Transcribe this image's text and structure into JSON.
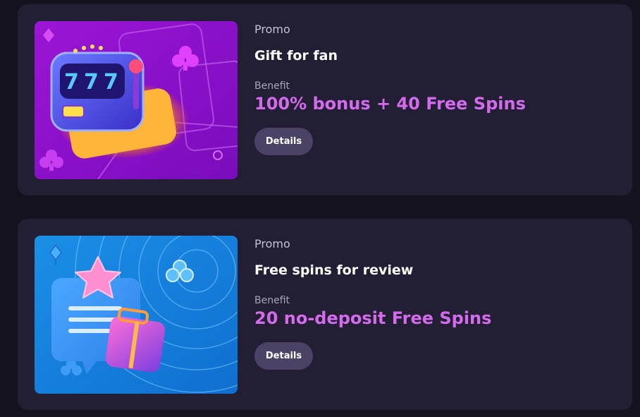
{
  "promos": [
    {
      "category_label": "Promo",
      "title": "Gift for fan",
      "benefit_label": "Benefit",
      "benefit_value": "100% bonus + 40 Free Spins",
      "button_label": "Details",
      "image_icon": "slot-machine-icon",
      "image_reel_text": "777"
    },
    {
      "category_label": "Promo",
      "title": "Free spins for review",
      "benefit_label": "Benefit",
      "benefit_value": "20 no-deposit Free Spins",
      "button_label": "Details",
      "image_icon": "review-speech-bubble-icon"
    }
  ],
  "colors": {
    "page_background": "#15121f",
    "card_background": "#221e33",
    "benefit_accent": "#d46bec",
    "button_background": "#4b4266"
  }
}
